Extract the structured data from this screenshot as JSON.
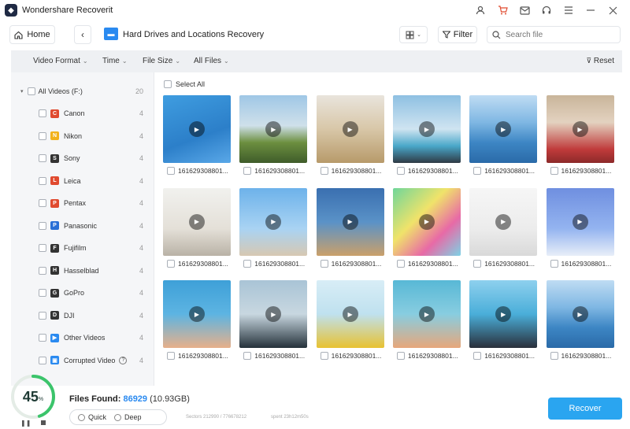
{
  "app": {
    "title": "Wondershare Recoverit"
  },
  "nav": {
    "home": "Home",
    "location_title": "Hard Drives and Locations Recovery",
    "filter": "Filter",
    "search_placeholder": "Search file"
  },
  "filters": {
    "video_format": "Video Format",
    "time": "Time",
    "file_size": "File Size",
    "all_files": "All Files",
    "reset": "Reset"
  },
  "sidebar": {
    "root": {
      "label": "All Videos (F:)",
      "count": "20"
    },
    "items": [
      {
        "label": "Canon",
        "count": "4",
        "icon": "C",
        "color": "#e04a2f"
      },
      {
        "label": "Nikon",
        "count": "4",
        "icon": "N",
        "color": "#f2b21b"
      },
      {
        "label": "Sony",
        "count": "4",
        "icon": "S",
        "color": "#333333"
      },
      {
        "label": "Leica",
        "count": "4",
        "icon": "L",
        "color": "#e04a2f"
      },
      {
        "label": "Pentax",
        "count": "4",
        "icon": "P",
        "color": "#e04a2f"
      },
      {
        "label": "Panasonic",
        "count": "4",
        "icon": "P",
        "color": "#2a6fd6"
      },
      {
        "label": "Fujifilm",
        "count": "4",
        "icon": "F",
        "color": "#333333"
      },
      {
        "label": "Hasselblad",
        "count": "4",
        "icon": "H",
        "color": "#333333"
      },
      {
        "label": "GoPro",
        "count": "4",
        "icon": "G",
        "color": "#333333"
      },
      {
        "label": "DJI",
        "count": "4",
        "icon": "D",
        "color": "#333333"
      },
      {
        "label": "Other Videos",
        "count": "4",
        "icon": "▶",
        "color": "#2a8af0"
      },
      {
        "label": "Corrupted Video",
        "count": "4",
        "icon": "▣",
        "color": "#2a8af0"
      }
    ]
  },
  "main": {
    "select_all": "Select All",
    "files": [
      "161629308801...",
      "161629308801...",
      "161629308801...",
      "161629308801...",
      "161629308801...",
      "161629308801...",
      "161629308801...",
      "161629308801...",
      "161629308801...",
      "161629308801...",
      "161629308801...",
      "161629308801...",
      "161629308801...",
      "161629308801...",
      "161629308801...",
      "161629308801...",
      "161629308801...",
      "161629308801..."
    ]
  },
  "footer": {
    "progress": 45,
    "progress_text": "45",
    "progress_unit": "%",
    "found_label": "Files Found:",
    "found_count": "86929",
    "found_size": "(10.93GB)",
    "quick": "Quick",
    "deep": "Deep",
    "sectors": "Sectors 212990 / 776678212",
    "spent": "spent 23h12m50s",
    "recover": "Recover"
  },
  "colors": {
    "accent": "#2aa5f0",
    "progress": "#3bc46b"
  }
}
